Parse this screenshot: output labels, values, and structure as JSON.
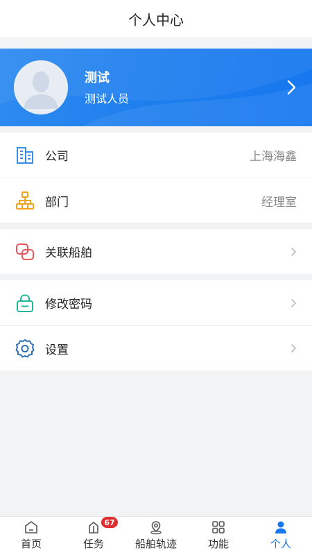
{
  "header": {
    "title": "个人中心"
  },
  "profile": {
    "name": "测试",
    "role": "测试人员"
  },
  "info_rows": [
    {
      "label": "公司",
      "value": "上海海鑫",
      "icon": "building-icon"
    },
    {
      "label": "部门",
      "value": "经理室",
      "icon": "org-chart-icon"
    }
  ],
  "linked_ships": {
    "label": "关联船舶",
    "icon": "link-icon"
  },
  "settings_rows": [
    {
      "label": "修改密码",
      "icon": "lock-icon"
    },
    {
      "label": "设置",
      "icon": "gear-icon"
    }
  ],
  "tabbar": {
    "tabs": [
      {
        "label": "首页",
        "icon": "home-icon"
      },
      {
        "label": "任务",
        "icon": "task-icon",
        "badge": "67"
      },
      {
        "label": "船舶轨迹",
        "icon": "ship-track-icon"
      },
      {
        "label": "功能",
        "icon": "grid-icon"
      },
      {
        "label": "个人",
        "icon": "person-icon",
        "active": true
      }
    ]
  },
  "colors": {
    "accent": "#1677ef",
    "badge": "#e02f2f",
    "background": "#f2f3f5"
  }
}
